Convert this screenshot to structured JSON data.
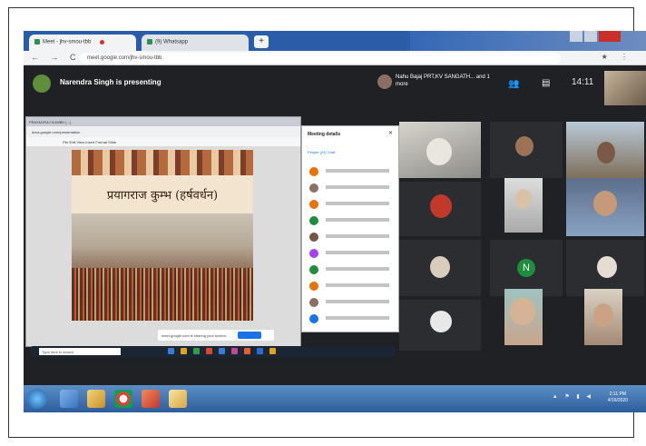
{
  "browser": {
    "tabs": [
      {
        "label": "Meet - jhv-smou-tbb"
      },
      {
        "label": "(9) Whatsapp"
      }
    ],
    "new_tab_symbol": "+",
    "url": "meet.google.com/jhv-smou-tbb",
    "nav_glyphs": "← → C",
    "ext_glyphs": "★ ⋮"
  },
  "meet": {
    "presenter_text": "Narendra Singh is presenting",
    "self_label": "Nahu Bajaj PRT,KV SANGATH... and 1 more",
    "people_icon": "👥",
    "chat_icon": "▤",
    "time": "14:11",
    "participants_panel": {
      "title": "Meeting details",
      "close_symbol": "✕",
      "tabs_label": "People (24)     Chat"
    },
    "stop_sharing_text": "meet.google.com is sharing your screen.",
    "shared_tab_label": "PRAYAGRAJ KUMBH (...)",
    "shared_address": "docs.google.com/presentation",
    "shared_toolbar": "File  Edit  View  Insert  Format  Slide",
    "taskbar_search": "Type here to search",
    "slide_title": "प्रयागराज कुम्भ (हर्षवर्धन)",
    "letter_avatar": "N"
  },
  "taskbar": {
    "tray_glyphs": "▲ ⚑ ▮ ◀",
    "time": "2:11 PM",
    "date": "4/16/2020"
  },
  "colors": {
    "meet_bg": "#202124",
    "accent_blue": "#1a73e8",
    "letter_avatar": "#1e8e3e"
  }
}
